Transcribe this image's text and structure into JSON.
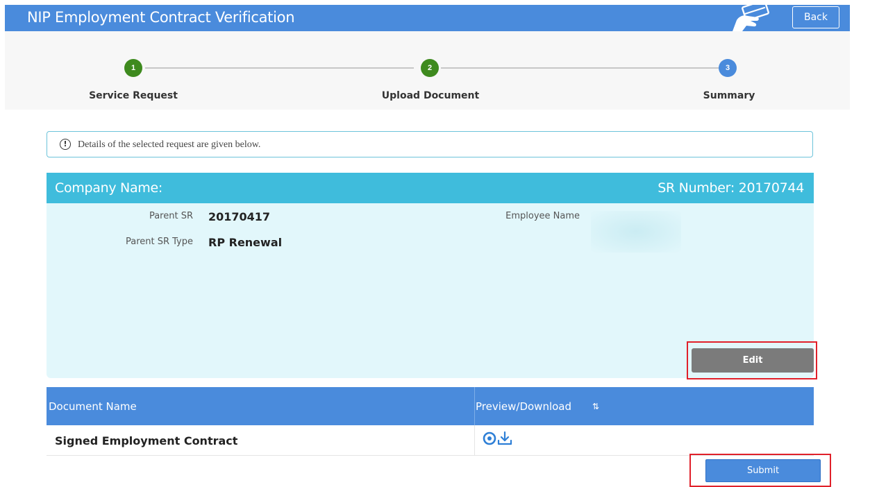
{
  "header": {
    "title": "NIP Employment Contract Verification",
    "back_label": "Back"
  },
  "stepper": {
    "steps": [
      {
        "number": "1",
        "label": "Service Request",
        "state": "done"
      },
      {
        "number": "2",
        "label": "Upload Document",
        "state": "done"
      },
      {
        "number": "3",
        "label": "Summary",
        "state": "current"
      }
    ]
  },
  "info": {
    "message": "Details of the selected request are given below."
  },
  "details": {
    "company_label": "Company Name:",
    "sr_number_label": "SR Number: 20170744",
    "parent_sr_label": "Parent SR",
    "parent_sr_value": "20170417",
    "parent_sr_type_label": "Parent SR Type",
    "parent_sr_type_value": "RP Renewal",
    "employee_name_label": "Employee Name",
    "edit_label": "Edit"
  },
  "documents": {
    "columns": [
      "Document Name",
      "Preview/Download"
    ],
    "sort_icon": "⇅",
    "rows": [
      {
        "name": "Signed Employment Contract"
      }
    ]
  },
  "actions": {
    "submit_label": "Submit"
  },
  "colors": {
    "header_blue": "#4a8bdc",
    "panel_header_cyan": "#3fbcdc",
    "panel_bg": "#e2f7fb",
    "step_done": "#3e8a1e",
    "highlight_red": "#e0202a",
    "edit_gray": "#7b7b7b"
  }
}
